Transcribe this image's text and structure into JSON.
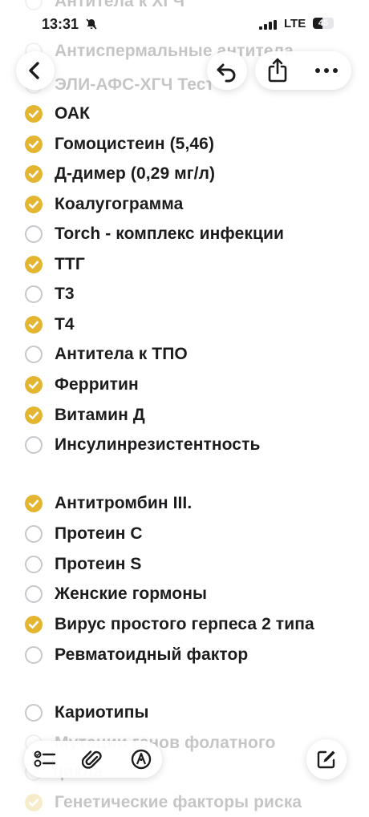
{
  "status": {
    "time": "13:31",
    "network": "LTE",
    "battery": "45"
  },
  "colors": {
    "accent": "#e3b530",
    "unchecked": "#c7c7cc"
  },
  "icons": {
    "back": "chevron-left-icon",
    "undo": "undo-icon",
    "share": "share-icon",
    "more": "more-icon",
    "checklist": "checklist-icon",
    "attach": "paperclip-icon",
    "markup": "pen-tip-icon",
    "compose": "compose-icon"
  },
  "checklist": [
    {
      "label": "Антитела к ХГЧ",
      "checked": false,
      "faded": true
    },
    {
      "label": "Антиспермальные антитела",
      "checked": false,
      "faded": true
    },
    {
      "label": "ЭЛИ-АФС-ХГЧ Тест",
      "checked": false,
      "faded": true
    },
    {
      "label": "ОАК",
      "checked": true
    },
    {
      "label": "Гомоцистеин (5,46)",
      "checked": true
    },
    {
      "label": "Д-димер (0,29 мг/л)",
      "checked": true
    },
    {
      "label": "Коалугограмма",
      "checked": true
    },
    {
      "label": "Torch - комплекс инфекции",
      "checked": false
    },
    {
      "label": "ТТГ",
      "checked": true
    },
    {
      "label": "Т3",
      "checked": false
    },
    {
      "label": "Т4",
      "checked": true
    },
    {
      "label": "Антитела к ТПО",
      "checked": false
    },
    {
      "label": "Ферритин",
      "checked": true
    },
    {
      "label": "Витамин Д",
      "checked": true
    },
    {
      "label": "Инсулинрезистентность",
      "checked": false
    },
    {
      "label": "Антитромбин III.",
      "checked": true
    },
    {
      "label": "Протеин С",
      "checked": false
    },
    {
      "label": "Протеин S",
      "checked": false
    },
    {
      "label": "Женские гормоны",
      "checked": false
    },
    {
      "label": "Вирус простого герпеса 2 типа",
      "checked": true
    },
    {
      "label": "Ревматоидный фактор",
      "checked": false
    },
    {
      "label": "Кариотипы",
      "checked": false
    },
    {
      "label": "Мутации генов фолатного",
      "checked": false,
      "faded": true
    },
    {
      "label": "цикла",
      "checked": false,
      "faded": true
    },
    {
      "label": "Генетические факторы риска",
      "checked": true,
      "faded": true
    }
  ]
}
